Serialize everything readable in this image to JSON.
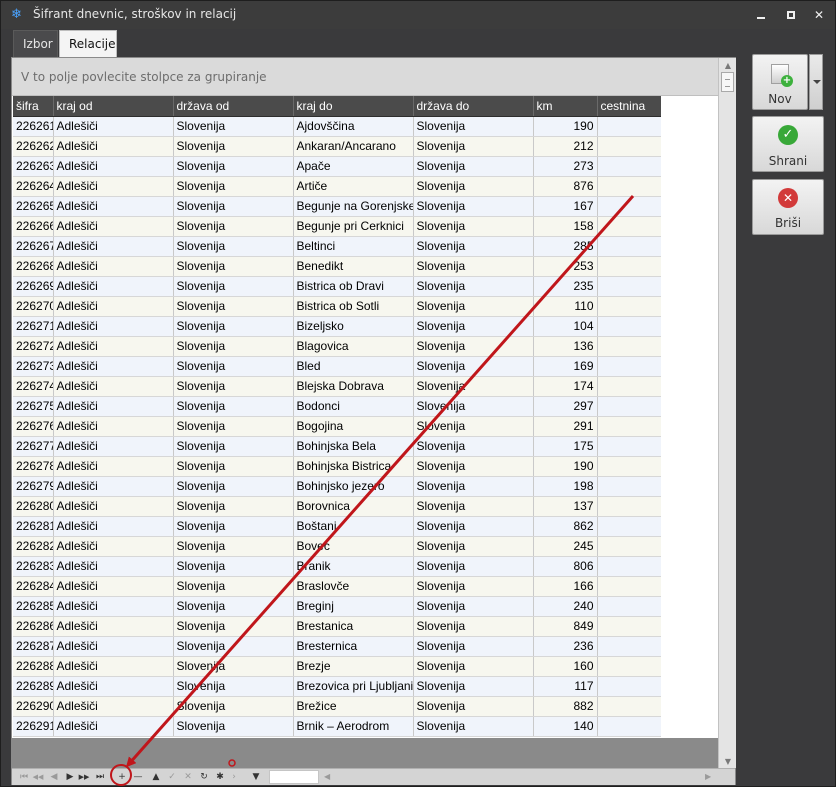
{
  "window": {
    "title": "Šifrant dnevnic, stroškov in relacij",
    "min_label": "",
    "max_label": "",
    "close_label": "✕"
  },
  "tabs": [
    {
      "label": "Izbor",
      "active": false
    },
    {
      "label": "Relacije",
      "active": true
    }
  ],
  "grid": {
    "group_hint": "V to polje povlecite stolpce za grupiranje",
    "columns": [
      "šifra",
      "kraj od",
      "država od",
      "kraj do",
      "država do",
      "km",
      "cestnina"
    ],
    "rows": [
      [
        "226261",
        "Adlešiči",
        "Slovenija",
        "Ajdovščina",
        "Slovenija",
        "190",
        ""
      ],
      [
        "226262",
        "Adlešiči",
        "Slovenija",
        "Ankaran/Ancarano",
        "Slovenija",
        "212",
        ""
      ],
      [
        "226263",
        "Adlešiči",
        "Slovenija",
        "Apače",
        "Slovenija",
        "273",
        ""
      ],
      [
        "226264",
        "Adlešiči",
        "Slovenija",
        "Artiče",
        "Slovenija",
        "876",
        ""
      ],
      [
        "226265",
        "Adlešiči",
        "Slovenija",
        "Begunje na Gorenjske",
        "Slovenija",
        "167",
        ""
      ],
      [
        "226266",
        "Adlešiči",
        "Slovenija",
        "Begunje pri Cerknici",
        "Slovenija",
        "158",
        ""
      ],
      [
        "226267",
        "Adlešiči",
        "Slovenija",
        "Beltinci",
        "Slovenija",
        "285",
        ""
      ],
      [
        "226268",
        "Adlešiči",
        "Slovenija",
        "Benedikt",
        "Slovenija",
        "253",
        ""
      ],
      [
        "226269",
        "Adlešiči",
        "Slovenija",
        "Bistrica ob Dravi",
        "Slovenija",
        "235",
        ""
      ],
      [
        "226270",
        "Adlešiči",
        "Slovenija",
        "Bistrica ob Sotli",
        "Slovenija",
        "110",
        ""
      ],
      [
        "226271",
        "Adlešiči",
        "Slovenija",
        "Bizeljsko",
        "Slovenija",
        "104",
        ""
      ],
      [
        "226272",
        "Adlešiči",
        "Slovenija",
        "Blagovica",
        "Slovenija",
        "136",
        ""
      ],
      [
        "226273",
        "Adlešiči",
        "Slovenija",
        "Bled",
        "Slovenija",
        "169",
        ""
      ],
      [
        "226274",
        "Adlešiči",
        "Slovenija",
        "Blejska Dobrava",
        "Slovenija",
        "174",
        ""
      ],
      [
        "226275",
        "Adlešiči",
        "Slovenija",
        "Bodonci",
        "Slovenija",
        "297",
        ""
      ],
      [
        "226276",
        "Adlešiči",
        "Slovenija",
        "Bogojina",
        "Slovenija",
        "291",
        ""
      ],
      [
        "226277",
        "Adlešiči",
        "Slovenija",
        "Bohinjska Bela",
        "Slovenija",
        "175",
        ""
      ],
      [
        "226278",
        "Adlešiči",
        "Slovenija",
        "Bohinjska Bistrica",
        "Slovenija",
        "190",
        ""
      ],
      [
        "226279",
        "Adlešiči",
        "Slovenija",
        "Bohinjsko jezero",
        "Slovenija",
        "198",
        ""
      ],
      [
        "226280",
        "Adlešiči",
        "Slovenija",
        "Borovnica",
        "Slovenija",
        "137",
        ""
      ],
      [
        "226281",
        "Adlešiči",
        "Slovenija",
        "Boštanj",
        "Slovenija",
        "862",
        ""
      ],
      [
        "226282",
        "Adlešiči",
        "Slovenija",
        "Bovec",
        "Slovenija",
        "245",
        ""
      ],
      [
        "226283",
        "Adlešiči",
        "Slovenija",
        "Branik",
        "Slovenija",
        "806",
        ""
      ],
      [
        "226284",
        "Adlešiči",
        "Slovenija",
        "Braslovče",
        "Slovenija",
        "166",
        ""
      ],
      [
        "226285",
        "Adlešiči",
        "Slovenija",
        "Breginj",
        "Slovenija",
        "240",
        ""
      ],
      [
        "226286",
        "Adlešiči",
        "Slovenija",
        "Brestanica",
        "Slovenija",
        "849",
        ""
      ],
      [
        "226287",
        "Adlešiči",
        "Slovenija",
        "Bresternica",
        "Slovenija",
        "236",
        ""
      ],
      [
        "226288",
        "Adlešiči",
        "Slovenija",
        "Brezje",
        "Slovenija",
        "160",
        ""
      ],
      [
        "226289",
        "Adlešiči",
        "Slovenija",
        "Brezovica pri Ljubljani",
        "Slovenija",
        "117",
        ""
      ],
      [
        "226290",
        "Adlešiči",
        "Slovenija",
        "Brežice",
        "Slovenija",
        "882",
        ""
      ],
      [
        "226291",
        "Adlešiči",
        "Slovenija",
        "Brnik – Aerodrom",
        "Slovenija",
        "140",
        ""
      ]
    ]
  },
  "navigator": {
    "icons": [
      {
        "name": "first-page-icon",
        "glyph": "⏮",
        "active": false
      },
      {
        "name": "prev-page-icon",
        "glyph": "◀◀",
        "active": false
      },
      {
        "name": "prev-record-icon",
        "glyph": "◀",
        "active": false
      },
      {
        "name": "next-record-icon",
        "glyph": "▶",
        "active": true
      },
      {
        "name": "next-page-icon",
        "glyph": "▶▶",
        "active": true
      },
      {
        "name": "last-page-icon",
        "glyph": "⏭",
        "active": true
      },
      {
        "name": "add-record-icon",
        "glyph": "+",
        "active": true
      },
      {
        "name": "delete-record-icon",
        "glyph": "—",
        "active": true
      },
      {
        "name": "edit-record-icon",
        "glyph": "▲",
        "active": true
      },
      {
        "name": "confirm-record-icon",
        "glyph": "✓",
        "active": false
      },
      {
        "name": "cancel-record-icon",
        "glyph": "✕",
        "active": false
      },
      {
        "name": "refresh-icon",
        "glyph": "↻",
        "active": true
      },
      {
        "name": "bookmark-icon",
        "glyph": "✱",
        "active": true
      },
      {
        "name": "goto-bookmark-icon",
        "glyph": "›",
        "active": false
      },
      {
        "name": "filter-icon",
        "glyph": "▼",
        "active": true
      }
    ]
  },
  "actions": {
    "new_label": "Nov",
    "save_label": "Shrani",
    "delete_label": "Briši"
  },
  "colors": {
    "annotation": "#c0161b",
    "accent_green": "#38a838",
    "accent_red": "#d23a3a"
  }
}
